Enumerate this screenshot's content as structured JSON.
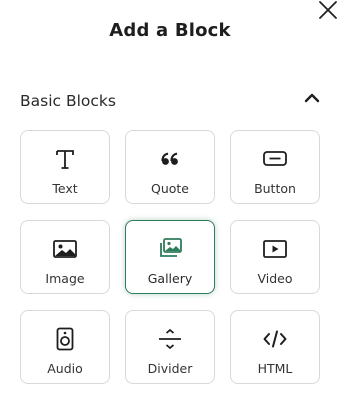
{
  "dialog": {
    "title": "Add a Block"
  },
  "section": {
    "title": "Basic Blocks"
  },
  "blocks": [
    {
      "label": "Text",
      "icon": "text-icon"
    },
    {
      "label": "Quote",
      "icon": "quote-icon"
    },
    {
      "label": "Button",
      "icon": "button-icon"
    },
    {
      "label": "Image",
      "icon": "image-icon"
    },
    {
      "label": "Gallery",
      "icon": "gallery-icon",
      "selected": true
    },
    {
      "label": "Video",
      "icon": "video-icon"
    },
    {
      "label": "Audio",
      "icon": "audio-icon"
    },
    {
      "label": "Divider",
      "icon": "divider-icon"
    },
    {
      "label": "HTML",
      "icon": "html-icon"
    }
  ],
  "colors": {
    "accent": "#2e7d5b",
    "icon": "#1e1e1e",
    "border": "#d9d9d9"
  }
}
